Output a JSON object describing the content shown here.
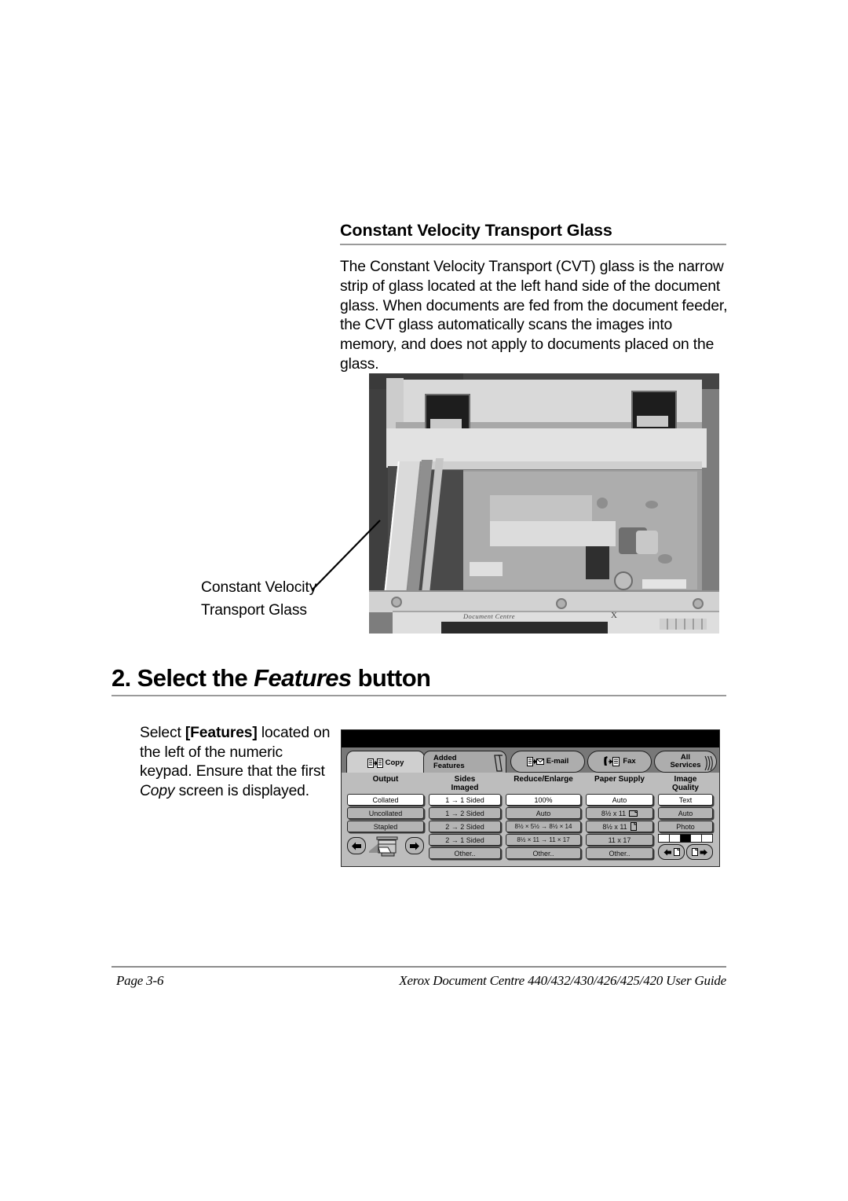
{
  "section1": {
    "heading": "Constant Velocity Transport Glass",
    "body": "The Constant Velocity Transport (CVT) glass is the narrow strip of glass located at the left hand side of the document glass. When documents are fed from the document feeder, the CVT glass automatically scans the images into memory, and does not apply to documents placed on the glass.",
    "caption_line1": "Constant Velocity",
    "caption_line2": "Transport Glass",
    "photo_machine_label": "Document Centre",
    "photo_mark": "X"
  },
  "section2": {
    "heading_number": "2.",
    "heading_text_before": "Select the",
    "heading_emphasis": "Features",
    "heading_text_after": "button",
    "instruction_part1": "Select ",
    "instruction_bold": "[Features]",
    "instruction_part2": " located on the left of the numeric keypad. Ensure that the first ",
    "instruction_italic": "Copy",
    "instruction_part3": " screen is displayed."
  },
  "ui_panel": {
    "tabs": [
      {
        "label": "Copy",
        "icon": "copy-document-icon",
        "active": true
      },
      {
        "label": "Added\nFeatures",
        "label_line1": "Added",
        "label_line2": "Features",
        "icon": "",
        "active": false
      },
      {
        "label": "E-mail",
        "icon": "email-envelope-icon",
        "active": false
      },
      {
        "label": "Fax",
        "icon": "fax-phone-icon",
        "active": false
      },
      {
        "label_line1": "All",
        "label_line2": "Services",
        "icon": "stacked-tabs-icon",
        "active": false
      }
    ],
    "columns": [
      {
        "header_line1": "Output",
        "header_line2": "",
        "buttons": [
          {
            "label": "Collated",
            "selected": true
          },
          {
            "label": "Uncollated",
            "selected": false
          },
          {
            "label": "Stapled",
            "selected": false
          }
        ],
        "nav": {
          "left_icon": "left-arrow-icon",
          "right_icon": "right-arrow-icon",
          "graphic": "copier-illustration"
        }
      },
      {
        "header_line1": "Sides",
        "header_line2": "Imaged",
        "buttons": [
          {
            "label": "1 → 1 Sided",
            "selected": true
          },
          {
            "label": "1 → 2 Sided",
            "selected": false
          },
          {
            "label": "2 → 2 Sided",
            "selected": false
          },
          {
            "label": "2 → 1 Sided",
            "selected": false
          },
          {
            "label": "Other..",
            "selected": false
          }
        ]
      },
      {
        "header_line1": "Reduce/Enlarge",
        "header_line2": "",
        "buttons": [
          {
            "label": "100%",
            "selected": true
          },
          {
            "label": "Auto",
            "selected": false
          },
          {
            "label": "8½ × 5½ → 8½ × 14",
            "selected": false
          },
          {
            "label": "8½ × 11 → 11 × 17",
            "selected": false
          },
          {
            "label": "Other..",
            "selected": false
          }
        ]
      },
      {
        "header_line1": "Paper Supply",
        "header_line2": "",
        "buttons": [
          {
            "label": "Auto",
            "selected": true
          },
          {
            "label": "8½ x 11",
            "selected": false,
            "page_icon": "landscape-page-icon"
          },
          {
            "label": "8½ x 11",
            "selected": false,
            "page_icon": "portrait-page-icon"
          },
          {
            "label": "11 x 17",
            "selected": false
          },
          {
            "label": "Other..",
            "selected": false
          }
        ]
      },
      {
        "header_line1": "Image",
        "header_line2": "Quality",
        "buttons": [
          {
            "label": "Text",
            "selected": true
          },
          {
            "label": "Auto",
            "selected": false
          },
          {
            "label": "Photo",
            "selected": false
          }
        ],
        "lightness_slider": {
          "segments": 5,
          "active_index": 2
        },
        "arrows": {
          "left_icon": "lighten-arrow-icon",
          "right_icon": "darken-arrow-icon"
        }
      }
    ]
  },
  "footer": {
    "page": "Page 3-6",
    "guide": "Xerox Document Centre 440/432/430/426/425/420 User Guide"
  }
}
